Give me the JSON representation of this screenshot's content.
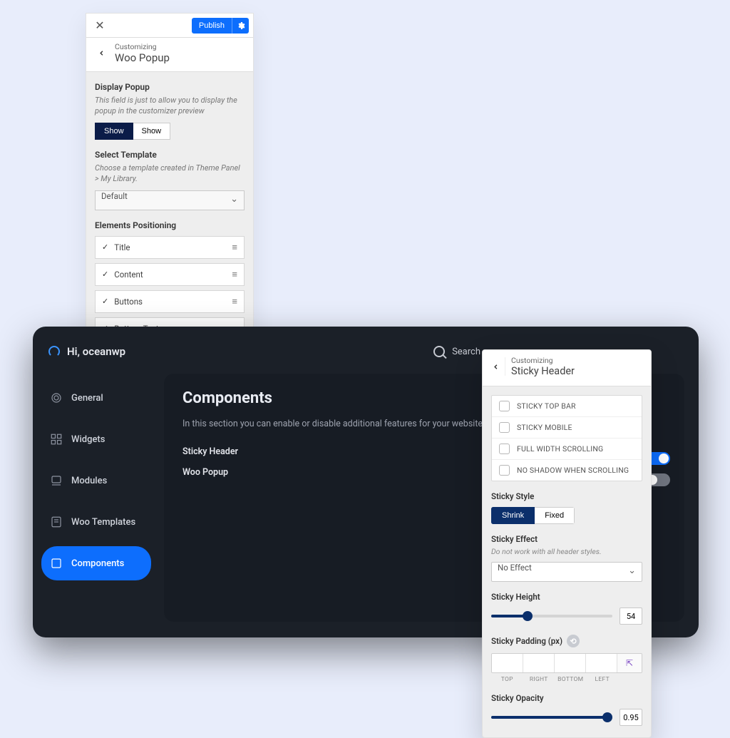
{
  "wooPanel": {
    "close": "✕",
    "publish": "Publish",
    "kicker": "Customizing",
    "title": "Woo Popup",
    "displayPopup": {
      "label": "Display Popup",
      "desc": "This field is just to allow you to display the popup in the customizer preview",
      "opt1": "Show",
      "opt2": "Show"
    },
    "selectTemplate": {
      "label": "Select Template",
      "desc": "Choose a template created in Theme Panel > My Library.",
      "value": "Default"
    },
    "elementsPositioning": {
      "label": "Elements Positioning",
      "items": [
        "Title",
        "Content",
        "Buttons",
        "Bottom Text"
      ]
    }
  },
  "dashboard": {
    "greeting": "Hi, oceanwp",
    "search": "Search",
    "sidebar": {
      "general": "General",
      "widgets": "Widgets",
      "modules": "Modules",
      "wooTemplates": "Woo Templates",
      "components": "Components"
    },
    "main": {
      "heading": "Components",
      "sub": "In this section you can enable or disable additional features for your website.",
      "links": [
        "Sticky Header",
        "Woo Popup"
      ]
    }
  },
  "stickyPanel": {
    "kicker": "Customizing",
    "title": "Sticky Header",
    "checks": [
      "STICKY TOP BAR",
      "STICKY MOBILE",
      "FULL WIDTH SCROLLING",
      "NO SHADOW WHEN SCROLLING"
    ],
    "stickyStyle": {
      "label": "Sticky Style",
      "shrink": "Shrink",
      "fixed": "Fixed"
    },
    "stickyEffect": {
      "label": "Sticky Effect",
      "desc": "Do not work with all header styles.",
      "value": "No Effect"
    },
    "stickyHeight": {
      "label": "Sticky Height",
      "value": "54",
      "percent": 30
    },
    "stickyPadding": {
      "label": "Sticky Padding (px)",
      "sides": [
        "TOP",
        "RIGHT",
        "BOTTOM",
        "LEFT"
      ]
    },
    "stickyOpacity": {
      "label": "Sticky Opacity",
      "value": "0.95",
      "percent": 96
    }
  }
}
